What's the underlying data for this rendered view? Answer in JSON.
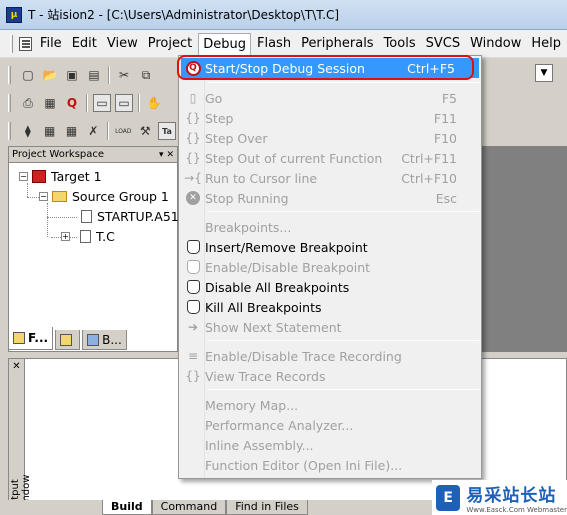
{
  "window": {
    "title": "T  - 站ision2 - [C:\\Users\\Administrator\\Desktop\\T\\T.C]"
  },
  "menubar": {
    "items": [
      "File",
      "Edit",
      "View",
      "Project",
      "Debug",
      "Flash",
      "Peripherals",
      "Tools",
      "SVCS",
      "Window",
      "Help"
    ],
    "active": "Debug"
  },
  "workspace": {
    "title": "Project Workspace",
    "tree": {
      "target": "Target 1",
      "group": "Source Group 1",
      "files": [
        "STARTUP.A51",
        "T.C"
      ]
    },
    "tabs": [
      "F...",
      "",
      "B..."
    ]
  },
  "output": {
    "side_label": "Output Window",
    "tabs": [
      "Build",
      "Command",
      "Find in Files"
    ]
  },
  "debug_menu": {
    "items": [
      {
        "label": "Start/Stop Debug Session",
        "shortcut": "Ctrl+F5",
        "enabled": true,
        "highlight": true,
        "icon": "debug-session-icon"
      },
      {
        "separator": true
      },
      {
        "label": "Go",
        "shortcut": "F5",
        "enabled": false,
        "icon": "go-icon"
      },
      {
        "label": "Step",
        "shortcut": "F11",
        "enabled": false,
        "icon": "step-icon"
      },
      {
        "label": "Step Over",
        "shortcut": "F10",
        "enabled": false,
        "icon": "step-over-icon"
      },
      {
        "label": "Step Out of current Function",
        "shortcut": "Ctrl+F11",
        "enabled": false,
        "icon": "step-out-icon"
      },
      {
        "label": "Run to Cursor line",
        "shortcut": "Ctrl+F10",
        "enabled": false,
        "icon": "run-to-cursor-icon"
      },
      {
        "label": "Stop Running",
        "shortcut": "Esc",
        "enabled": false,
        "icon": "stop-icon"
      },
      {
        "separator": true
      },
      {
        "label": "Breakpoints...",
        "shortcut": "",
        "enabled": false,
        "icon": ""
      },
      {
        "label": "Insert/Remove Breakpoint",
        "shortcut": "",
        "enabled": true,
        "icon": "hand-icon"
      },
      {
        "label": "Enable/Disable Breakpoint",
        "shortcut": "",
        "enabled": false,
        "icon": "hand-icon"
      },
      {
        "label": "Disable All Breakpoints",
        "shortcut": "",
        "enabled": true,
        "icon": "hand-icon"
      },
      {
        "label": "Kill All Breakpoints",
        "shortcut": "",
        "enabled": true,
        "icon": "hand-icon"
      },
      {
        "label": "Show Next Statement",
        "shortcut": "",
        "enabled": false,
        "icon": "arrow-icon"
      },
      {
        "separator": true
      },
      {
        "label": "Enable/Disable Trace Recording",
        "shortcut": "",
        "enabled": false,
        "icon": "trace-icon"
      },
      {
        "label": "View Trace Records",
        "shortcut": "",
        "enabled": false,
        "icon": "trace-records-icon"
      },
      {
        "separator": true
      },
      {
        "label": "Memory Map...",
        "shortcut": "",
        "enabled": false,
        "icon": ""
      },
      {
        "label": "Performance Analyzer...",
        "shortcut": "",
        "enabled": false,
        "icon": ""
      },
      {
        "label": "Inline Assembly...",
        "shortcut": "",
        "enabled": false,
        "icon": ""
      },
      {
        "label": "Function Editor (Open Ini File)...",
        "shortcut": "",
        "enabled": false,
        "icon": ""
      }
    ]
  },
  "watermark": {
    "logo": "E",
    "text_cn": "易采站长站",
    "text_en": "Www.Easck.Com Webmaster"
  },
  "toolbar": {
    "load_label": "LOAD"
  }
}
